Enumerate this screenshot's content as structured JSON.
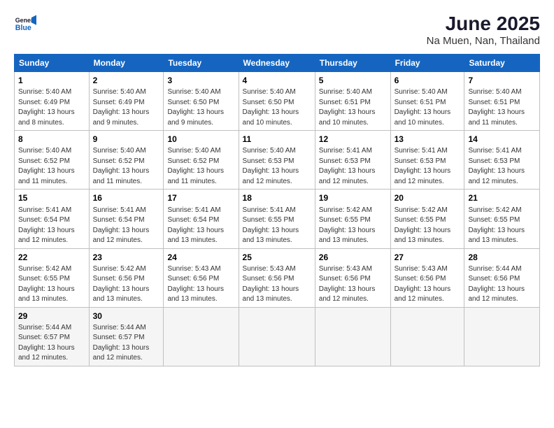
{
  "logo": {
    "general": "General",
    "blue": "Blue"
  },
  "title": "June 2025",
  "subtitle": "Na Muen, Nan, Thailand",
  "days_of_week": [
    "Sunday",
    "Monday",
    "Tuesday",
    "Wednesday",
    "Thursday",
    "Friday",
    "Saturday"
  ],
  "weeks": [
    [
      {
        "day": 1,
        "sunrise": "5:40 AM",
        "sunset": "6:49 PM",
        "daylight": "13 hours and 8 minutes."
      },
      {
        "day": 2,
        "sunrise": "5:40 AM",
        "sunset": "6:49 PM",
        "daylight": "13 hours and 9 minutes."
      },
      {
        "day": 3,
        "sunrise": "5:40 AM",
        "sunset": "6:50 PM",
        "daylight": "13 hours and 9 minutes."
      },
      {
        "day": 4,
        "sunrise": "5:40 AM",
        "sunset": "6:50 PM",
        "daylight": "13 hours and 10 minutes."
      },
      {
        "day": 5,
        "sunrise": "5:40 AM",
        "sunset": "6:51 PM",
        "daylight": "13 hours and 10 minutes."
      },
      {
        "day": 6,
        "sunrise": "5:40 AM",
        "sunset": "6:51 PM",
        "daylight": "13 hours and 10 minutes."
      },
      {
        "day": 7,
        "sunrise": "5:40 AM",
        "sunset": "6:51 PM",
        "daylight": "13 hours and 11 minutes."
      }
    ],
    [
      {
        "day": 8,
        "sunrise": "5:40 AM",
        "sunset": "6:52 PM",
        "daylight": "13 hours and 11 minutes."
      },
      {
        "day": 9,
        "sunrise": "5:40 AM",
        "sunset": "6:52 PM",
        "daylight": "13 hours and 11 minutes."
      },
      {
        "day": 10,
        "sunrise": "5:40 AM",
        "sunset": "6:52 PM",
        "daylight": "13 hours and 11 minutes."
      },
      {
        "day": 11,
        "sunrise": "5:40 AM",
        "sunset": "6:53 PM",
        "daylight": "13 hours and 12 minutes."
      },
      {
        "day": 12,
        "sunrise": "5:41 AM",
        "sunset": "6:53 PM",
        "daylight": "13 hours and 12 minutes."
      },
      {
        "day": 13,
        "sunrise": "5:41 AM",
        "sunset": "6:53 PM",
        "daylight": "13 hours and 12 minutes."
      },
      {
        "day": 14,
        "sunrise": "5:41 AM",
        "sunset": "6:53 PM",
        "daylight": "13 hours and 12 minutes."
      }
    ],
    [
      {
        "day": 15,
        "sunrise": "5:41 AM",
        "sunset": "6:54 PM",
        "daylight": "13 hours and 12 minutes."
      },
      {
        "day": 16,
        "sunrise": "5:41 AM",
        "sunset": "6:54 PM",
        "daylight": "13 hours and 12 minutes."
      },
      {
        "day": 17,
        "sunrise": "5:41 AM",
        "sunset": "6:54 PM",
        "daylight": "13 hours and 13 minutes."
      },
      {
        "day": 18,
        "sunrise": "5:41 AM",
        "sunset": "6:55 PM",
        "daylight": "13 hours and 13 minutes."
      },
      {
        "day": 19,
        "sunrise": "5:42 AM",
        "sunset": "6:55 PM",
        "daylight": "13 hours and 13 minutes."
      },
      {
        "day": 20,
        "sunrise": "5:42 AM",
        "sunset": "6:55 PM",
        "daylight": "13 hours and 13 minutes."
      },
      {
        "day": 21,
        "sunrise": "5:42 AM",
        "sunset": "6:55 PM",
        "daylight": "13 hours and 13 minutes."
      }
    ],
    [
      {
        "day": 22,
        "sunrise": "5:42 AM",
        "sunset": "6:55 PM",
        "daylight": "13 hours and 13 minutes."
      },
      {
        "day": 23,
        "sunrise": "5:42 AM",
        "sunset": "6:56 PM",
        "daylight": "13 hours and 13 minutes."
      },
      {
        "day": 24,
        "sunrise": "5:43 AM",
        "sunset": "6:56 PM",
        "daylight": "13 hours and 13 minutes."
      },
      {
        "day": 25,
        "sunrise": "5:43 AM",
        "sunset": "6:56 PM",
        "daylight": "13 hours and 13 minutes."
      },
      {
        "day": 26,
        "sunrise": "5:43 AM",
        "sunset": "6:56 PM",
        "daylight": "13 hours and 12 minutes."
      },
      {
        "day": 27,
        "sunrise": "5:43 AM",
        "sunset": "6:56 PM",
        "daylight": "13 hours and 12 minutes."
      },
      {
        "day": 28,
        "sunrise": "5:44 AM",
        "sunset": "6:56 PM",
        "daylight": "13 hours and 12 minutes."
      }
    ],
    [
      {
        "day": 29,
        "sunrise": "5:44 AM",
        "sunset": "6:57 PM",
        "daylight": "13 hours and 12 minutes."
      },
      {
        "day": 30,
        "sunrise": "5:44 AM",
        "sunset": "6:57 PM",
        "daylight": "13 hours and 12 minutes."
      },
      null,
      null,
      null,
      null,
      null
    ]
  ]
}
